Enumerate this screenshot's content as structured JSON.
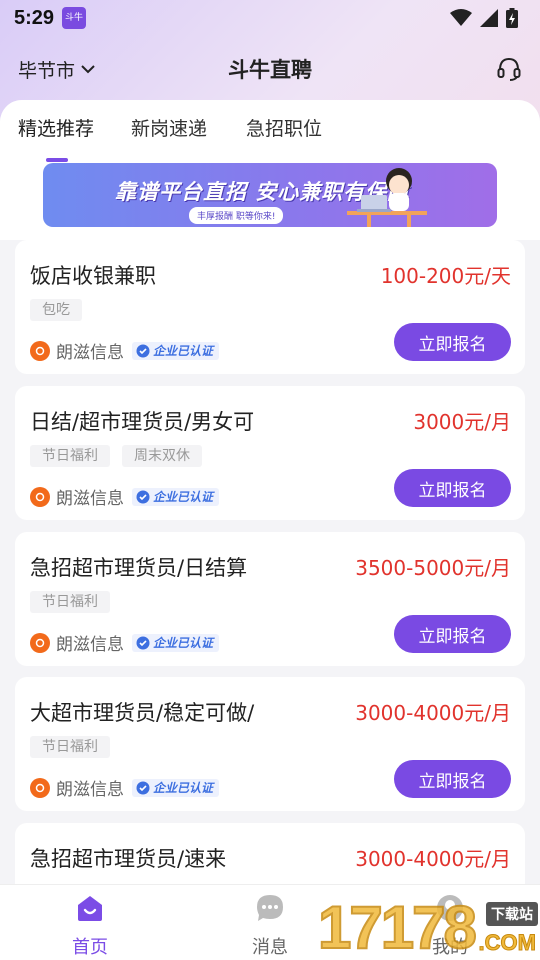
{
  "status_bar": {
    "time": "5:29",
    "app_badge": "斗牛"
  },
  "header": {
    "city": "毕节市",
    "title": "斗牛直聘"
  },
  "tabs": [
    {
      "label": "精选推荐",
      "active": true
    },
    {
      "label": "新岗速递",
      "active": false
    },
    {
      "label": "急招职位",
      "active": false
    }
  ],
  "banner": {
    "title": "靠谱平台直招 安心兼职有保障",
    "subtitle": "丰厚报酬 职等你来!"
  },
  "jobs": [
    {
      "title": "饭店收银兼职",
      "salary": "100-200元/天",
      "tags": [
        "包吃"
      ],
      "company": "朗滋信息",
      "verified": "企业已认证",
      "apply": "立即报名"
    },
    {
      "title": "日结/超市理货员/男女可",
      "salary": "3000元/月",
      "tags": [
        "节日福利",
        "周末双休"
      ],
      "company": "朗滋信息",
      "verified": "企业已认证",
      "apply": "立即报名"
    },
    {
      "title": "急招超市理货员/日结算",
      "salary": "3500-5000元/月",
      "tags": [
        "节日福利"
      ],
      "company": "朗滋信息",
      "verified": "企业已认证",
      "apply": "立即报名"
    },
    {
      "title": "大超市理货员/稳定可做/",
      "salary": "3000-4000元/月",
      "tags": [
        "节日福利"
      ],
      "company": "朗滋信息",
      "verified": "企业已认证",
      "apply": "立即报名"
    },
    {
      "title": "急招超市理货员/速来",
      "salary": "3000-4000元/月"
    }
  ],
  "bottom_nav": [
    {
      "label": "首页",
      "icon": "home-icon",
      "active": true
    },
    {
      "label": "消息",
      "icon": "message-icon",
      "active": false
    },
    {
      "label": "我的",
      "icon": "profile-icon",
      "active": false
    }
  ],
  "watermark": {
    "digits": "17178",
    "badge": "下载站",
    "suffix": ".COM"
  },
  "colors": {
    "accent": "#7a4ae3",
    "salary": "#e1332d",
    "verified": "#3d6fe0"
  }
}
